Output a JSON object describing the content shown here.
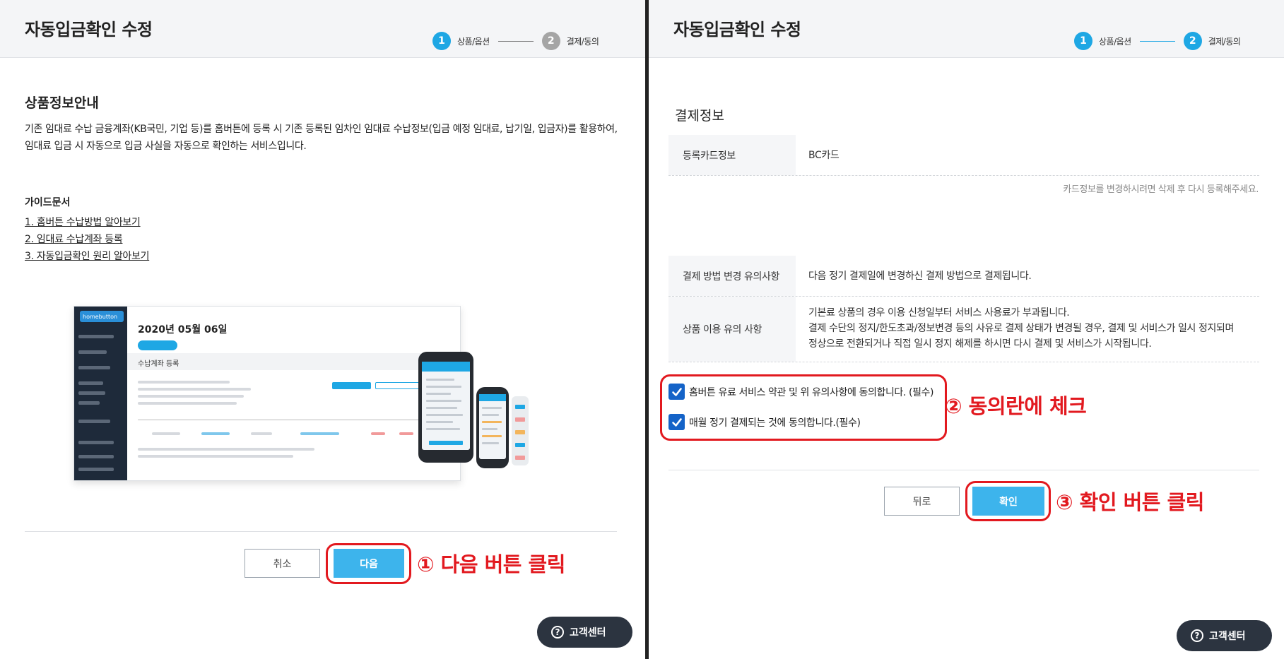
{
  "left": {
    "title": "자동입금확인 수정",
    "steps": [
      {
        "num": "1",
        "label": "상품/옵션"
      },
      {
        "num": "2",
        "label": "결제/동의"
      }
    ],
    "section_title": "상품정보안내",
    "description": "기존 임대료 수납 금융계좌(KB국민, 기업 등)를 홈버튼에 등록 시 기존 등록된 임차인 임대료 수납정보(입금 예정 임대료, 납기일, 입금자)를 활용하여, 임대료 입금 시 자동으로 입금 사실을 자동으로 확인하는 서비스입니다.",
    "guide_title": "가이드문서",
    "guide_links": [
      "1. 홈버튼 수납방법 알아보기",
      "2. 임대료 수납계좌 등록",
      "3. 자동입금확인 원리 알아보기"
    ],
    "preview": {
      "logo": "homebutton",
      "date": "2020년 05월 06일",
      "subtitle": "수납계좌 등록"
    },
    "cancel_label": "취소",
    "next_label": "다음",
    "annotation": "① 다음 버튼 클릭",
    "help_label": "고객센터"
  },
  "right": {
    "title": "자동입금확인 수정",
    "steps": [
      {
        "num": "1",
        "label": "상품/옵션"
      },
      {
        "num": "2",
        "label": "결제/동의"
      }
    ],
    "payment_title": "결제정보",
    "card_label": "등록카드정보",
    "card_value": "BC카드",
    "card_note": "카드정보를 변경하시려면 삭제 후 다시 등록해주세요.",
    "change_label": "결제 방법 변경 유의사항",
    "change_value": "다음 정기 결제일에 변경하신 결제 방법으로 결제됩니다.",
    "usage_label": "상품 이용 유의 사항",
    "usage_lines": [
      "기본료 상품의 경우 이용 신청일부터 서비스 사용료가 부과됩니다.",
      "결제 수단의 정지/한도초과/정보변경 등의 사유로 결제 상태가 변경될 경우, 결제 및 서비스가 일시 정지되며",
      "정상으로 전환되거나 직접 일시 정지 해제를 하시면 다시 결제 및 서비스가 시작됩니다."
    ],
    "agree_1": "홈버튼 유료 서비스 약관 및 위 유의사항에 동의합니다. (필수)",
    "agree_2": "매월 정기 결제되는 것에 동의합니다.(필수)",
    "agree_1_checked": true,
    "agree_2_checked": true,
    "annotation_agree": "② 동의란에 체크",
    "back_label": "뒤로",
    "confirm_label": "확인",
    "annotation_confirm": "③ 확인 버튼 클릭",
    "help_label": "고객센터"
  },
  "colors": {
    "accent": "#1ea7e4",
    "button": "#3db4ec",
    "annotation": "#e2191f",
    "checkbox": "#1463c8",
    "help_bg": "#2c3440"
  }
}
